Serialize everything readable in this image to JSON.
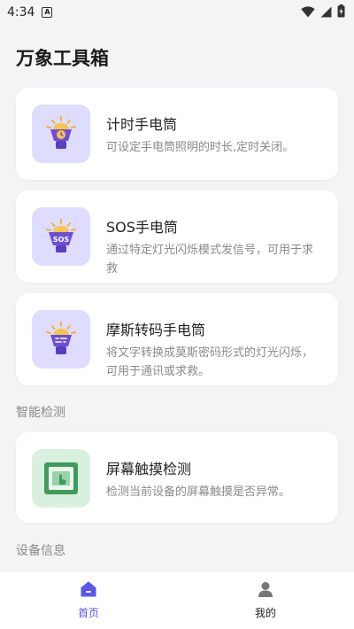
{
  "status_bar": {
    "time": "4:34",
    "notification_glyph": "A",
    "icons": [
      "wifi-icon",
      "signal-icon",
      "battery-icon"
    ]
  },
  "app": {
    "title": "万象工具箱"
  },
  "cards": [
    {
      "title": "计时手电筒",
      "description": "可设定手电筒照明的时长,定时关闭。",
      "icon": "timer-flashlight-icon"
    },
    {
      "title": "SOS手电筒",
      "description": "通过特定灯光闪烁模式发信号，可用于求救",
      "icon": "sos-flashlight-icon",
      "icon_text": "SOS"
    },
    {
      "title": "摩斯转码手电筒",
      "description": "将文字转换成莫斯密码形式的灯光闪烁，可用于通讯或求救。",
      "icon": "morse-flashlight-icon"
    }
  ],
  "sections": {
    "smart_detect": "智能检测",
    "device_info": "设备信息"
  },
  "detect_card": {
    "title": "屏幕触摸检测",
    "description": "检测当前设备的屏幕触摸是否异常。",
    "icon": "touch-screen-icon"
  },
  "bottom_nav": {
    "items": [
      {
        "label": "首页",
        "icon": "home-icon",
        "active": true
      },
      {
        "label": "我的",
        "icon": "user-icon",
        "active": false
      }
    ]
  },
  "colors": {
    "accent": "#5b56f0",
    "icon_bg_purple": "#dedcff",
    "icon_bg_green": "#d8f0dd",
    "page_bg": "#f4f4f6"
  }
}
